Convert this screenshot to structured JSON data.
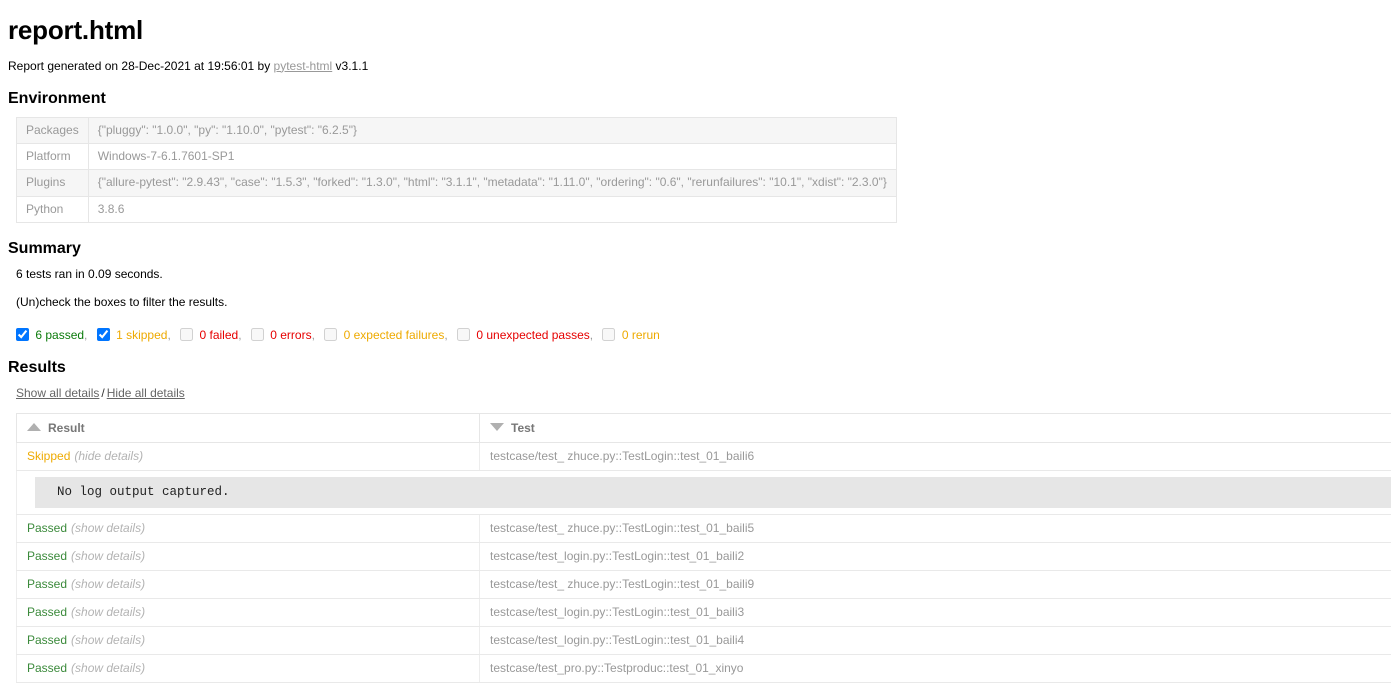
{
  "report": {
    "title": "report.html",
    "generated_prefix": "Report generated on ",
    "generated_datetime": "28-Dec-2021 at 19:56:01",
    "generated_by": " by ",
    "tool_link": "pytest-html",
    "tool_version": " v3.1.1"
  },
  "environment": {
    "heading": "Environment",
    "rows": [
      {
        "key": "Packages",
        "value": "{\"pluggy\": \"1.0.0\", \"py\": \"1.10.0\", \"pytest\": \"6.2.5\"}"
      },
      {
        "key": "Platform",
        "value": "Windows-7-6.1.7601-SP1"
      },
      {
        "key": "Plugins",
        "value": "{\"allure-pytest\": \"2.9.43\", \"case\": \"1.5.3\", \"forked\": \"1.3.0\", \"html\": \"3.1.1\", \"metadata\": \"1.11.0\", \"ordering\": \"0.6\", \"rerunfailures\": \"10.1\", \"xdist\": \"2.3.0\"}"
      },
      {
        "key": "Python",
        "value": "3.8.6"
      }
    ]
  },
  "summary": {
    "heading": "Summary",
    "run_line": "6 tests ran in 0.09 seconds.",
    "filter_hint": "(Un)check the boxes to filter the results.",
    "filters": [
      {
        "name": "passed",
        "label": "6 passed",
        "checked": true,
        "disabled": false,
        "separator": ","
      },
      {
        "name": "skipped",
        "label": "1 skipped",
        "checked": true,
        "disabled": false,
        "separator": ","
      },
      {
        "name": "failed",
        "label": "0 failed",
        "checked": false,
        "disabled": true,
        "separator": ","
      },
      {
        "name": "error",
        "label": "0 errors",
        "checked": false,
        "disabled": true,
        "separator": ","
      },
      {
        "name": "xfailed",
        "label": "0 expected failures",
        "checked": false,
        "disabled": true,
        "separator": ","
      },
      {
        "name": "xpassed",
        "label": "0 unexpected passes",
        "checked": false,
        "disabled": true,
        "separator": ","
      },
      {
        "name": "rerun",
        "label": "0 rerun",
        "checked": false,
        "disabled": true,
        "separator": ""
      }
    ]
  },
  "results": {
    "heading": "Results",
    "show_all": "Show all details",
    "separator": "/",
    "hide_all": "Hide all details",
    "columns": [
      {
        "key": "result",
        "label": "Result",
        "sort": "asc"
      },
      {
        "key": "test",
        "label": "Test",
        "sort": "desc"
      }
    ],
    "rows": [
      {
        "result": "Skipped",
        "result_class": "result-skipped",
        "toggle": "(hide details)",
        "test": "testcase/test_ zhuce.py::TestLogin::test_01_baili6",
        "log": "No log output captured."
      },
      {
        "result": "Passed",
        "result_class": "result-passed",
        "toggle": "(show details)",
        "test": "testcase/test_ zhuce.py::TestLogin::test_01_baili5",
        "log": null
      },
      {
        "result": "Passed",
        "result_class": "result-passed",
        "toggle": "(show details)",
        "test": "testcase/test_login.py::TestLogin::test_01_baili2",
        "log": null
      },
      {
        "result": "Passed",
        "result_class": "result-passed",
        "toggle": "(show details)",
        "test": "testcase/test_ zhuce.py::TestLogin::test_01_baili9",
        "log": null
      },
      {
        "result": "Passed",
        "result_class": "result-passed",
        "toggle": "(show details)",
        "test": "testcase/test_login.py::TestLogin::test_01_baili3",
        "log": null
      },
      {
        "result": "Passed",
        "result_class": "result-passed",
        "toggle": "(show details)",
        "test": "testcase/test_login.py::TestLogin::test_01_baili4",
        "log": null
      },
      {
        "result": "Passed",
        "result_class": "result-passed",
        "toggle": "(show details)",
        "test": "testcase/test_pro.py::Testproduc::test_01_xinyo",
        "log": null
      }
    ]
  },
  "colors": {
    "passed": "#3b8a3b",
    "skipped": "#eeaa00",
    "failed": "#e60000",
    "link": "#999999",
    "muted": "#999999",
    "checkbox_accent": "#1a73e8"
  }
}
